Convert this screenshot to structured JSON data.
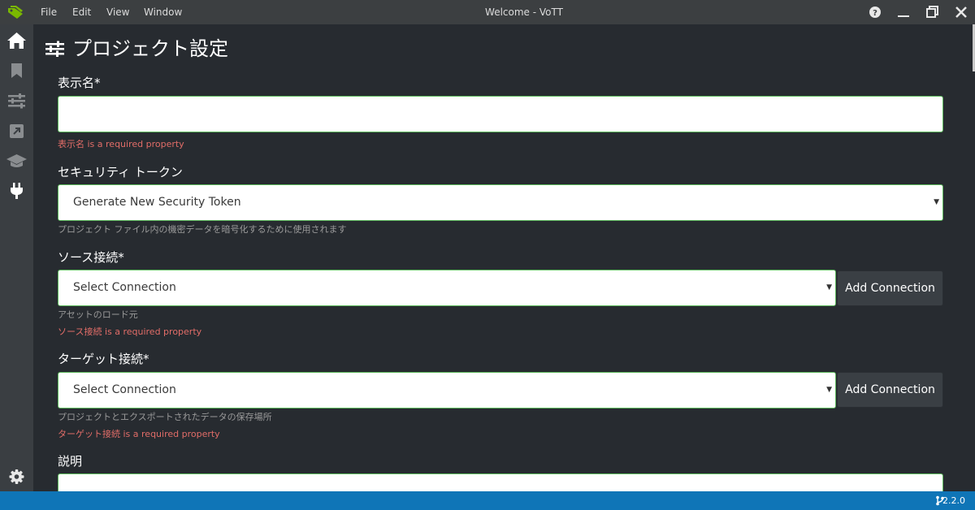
{
  "titlebar": {
    "menus": [
      "File",
      "Edit",
      "View",
      "Window"
    ],
    "title": "Welcome - VoTT"
  },
  "sidebar": {
    "items": [
      "home-icon",
      "bookmark-icon",
      "sliders-icon",
      "external-link-icon",
      "graduation-cap-icon",
      "plug-icon"
    ],
    "settings": "gear-icon"
  },
  "page": {
    "title": "プロジェクト設定",
    "title_icon": "sliders-icon"
  },
  "form": {
    "display_name": {
      "label": "表示名*",
      "value": "",
      "error": "表示名 is a required property"
    },
    "security_token": {
      "label": "セキュリティ トークン",
      "selected": "Generate New Security Token",
      "help": "プロジェクト ファイル内の機密データを暗号化するために使用されます"
    },
    "source_connection": {
      "label": "ソース接続*",
      "selected": "Select Connection",
      "button": "Add Connection",
      "help": "アセットのロード元",
      "error": "ソース接続 is a required property"
    },
    "target_connection": {
      "label": "ターゲット接続*",
      "selected": "Select Connection",
      "button": "Add Connection",
      "help": "プロジェクトとエクスポートされたデータの保存場所",
      "error": "ターゲット接続 is a required property"
    },
    "description": {
      "label": "説明",
      "value": ""
    }
  },
  "statusbar": {
    "version": "2.2.0"
  },
  "colors": {
    "accent_green": "#5cb85c",
    "error_red": "#e26d68",
    "status_blue": "#0f75b7",
    "logo_green": "#7ab800"
  }
}
